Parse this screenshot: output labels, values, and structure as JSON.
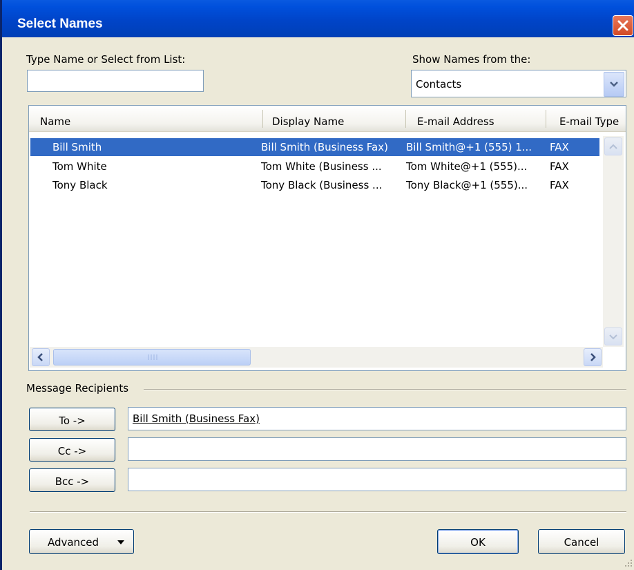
{
  "window": {
    "title": "Select Names"
  },
  "search": {
    "label": "Type Name or Select from List:",
    "value": ""
  },
  "address_book": {
    "label": "Show Names from the:",
    "selected": "Contacts"
  },
  "list": {
    "columns": [
      "Name",
      "Display Name",
      "E-mail Address",
      "E-mail Type"
    ],
    "rows": [
      {
        "name": "Bill Smith",
        "display": "Bill Smith (Business Fax)",
        "email": "Bill Smith@+1 (555) 1...",
        "type": "FAX",
        "selected": true
      },
      {
        "name": "Tom White",
        "display": "Tom White (Business ...",
        "email": "Tom White@+1 (555)...",
        "type": "FAX",
        "selected": false
      },
      {
        "name": "Tony Black",
        "display": "Tony Black (Business ...",
        "email": "Tony Black@+1 (555)...",
        "type": "FAX",
        "selected": false
      }
    ]
  },
  "recipients": {
    "group_label": "Message Recipients",
    "to_label": "To ->",
    "to_value": "Bill Smith (Business Fax)",
    "cc_label": "Cc ->",
    "cc_value": "",
    "bcc_label": "Bcc ->",
    "bcc_value": ""
  },
  "footer": {
    "advanced": "Advanced",
    "ok": "OK",
    "cancel": "Cancel"
  },
  "colors": {
    "titlebar": "#0050dc",
    "selection": "#316ac5",
    "close": "#d24a25"
  },
  "icons": [
    "close-icon",
    "chevron-down-icon",
    "arrow-up-icon",
    "arrow-down-icon",
    "arrow-left-icon",
    "arrow-right-icon",
    "resize-grip-icon"
  ]
}
